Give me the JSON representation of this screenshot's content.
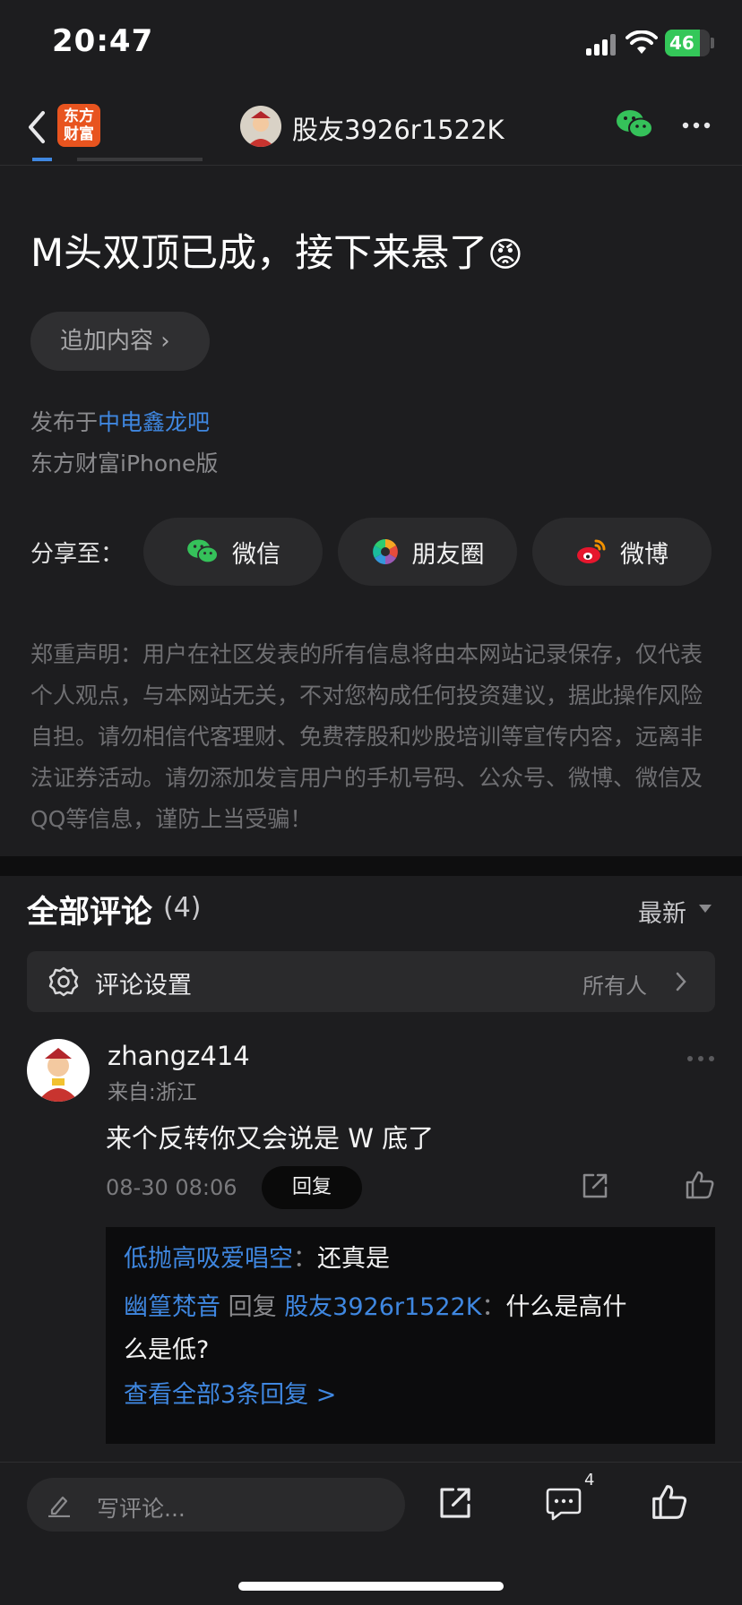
{
  "status_bar": {
    "time": "20:47",
    "battery": "46"
  },
  "nav": {
    "logo_text": "东方财富",
    "username": "股友3926r1522K"
  },
  "post": {
    "title": "M头双顶已成，接下来悬了",
    "title_emoji": "😡",
    "add_content_label": "追加内容 ›",
    "published_prefix": "发布于",
    "published_forum": "中电鑫龙吧",
    "source": "东方财富iPhone版",
    "share_label": "分享至：",
    "share_targets": [
      "微信",
      "朋友圈",
      "微博"
    ],
    "disclaimer": "郑重声明：用户在社区发表的所有信息将由本网站记录保存，仅代表个人观点，与本网站无关，不对您构成任何投资建议，据此操作风险自担。请勿相信代客理财、免费荐股和炒股培训等宣传内容，远离非法证券活动。请勿添加发言用户的手机号码、公众号、微博、微信及QQ等信息，谨防上当受骗！"
  },
  "comments": {
    "title": "全部评论",
    "count": "(4)",
    "sort": "最新",
    "settings_label": "评论设置",
    "settings_value": "所有人",
    "items": [
      {
        "user": "zhangz414",
        "from": "来自:浙江",
        "text": "来个反转你又会说是 W 底了",
        "time": "08-30 08:06",
        "reply_label": "回复",
        "replies": {
          "r1_user": "低抛高吸爱唱空",
          "r1_text": "还真是",
          "r2_user": "幽篁梵音",
          "r2_mid": "回复",
          "r2_target": "股友3926r1522K",
          "r2_text_a": "什么是高什",
          "r2_text_b": "么是低?",
          "view_all": "查看全部3条回复 >"
        }
      }
    ]
  },
  "bottom_bar": {
    "placeholder": "写评论...",
    "comment_count": "4"
  },
  "colors": {
    "accent_blue": "#3f87e0",
    "logo_orange": "#e8541f",
    "battery_green": "#34c759"
  }
}
